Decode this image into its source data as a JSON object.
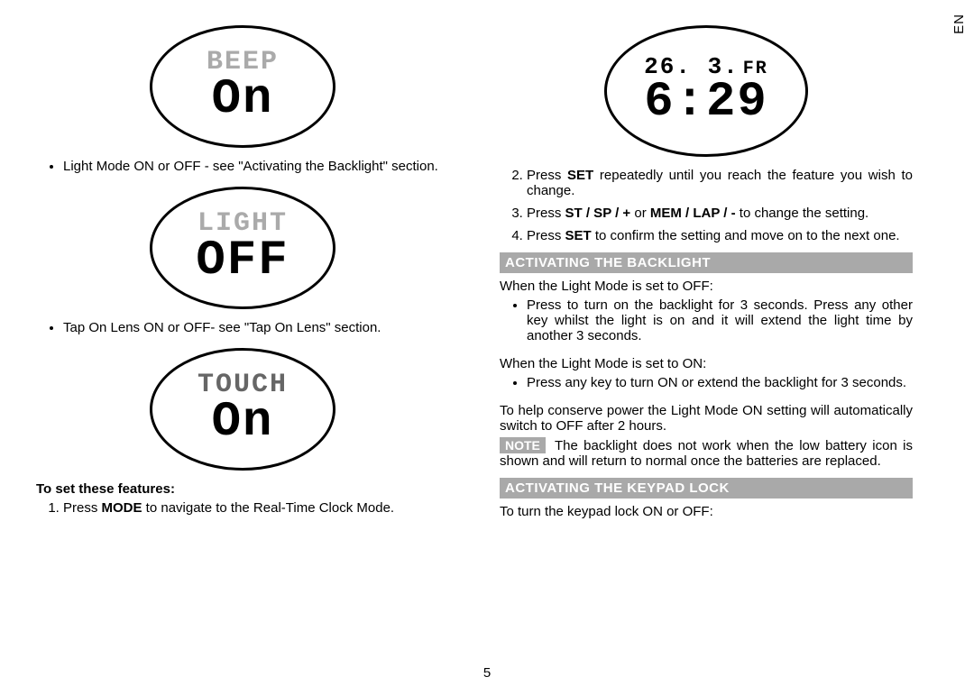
{
  "lang_tab": "EN",
  "page_number": "5",
  "left": {
    "lcd_beep_top": "BEEP",
    "lcd_beep_main": "On",
    "bullet_light_mode": "Light Mode ON or OFF - see \"Activating the Backlight\" section.",
    "lcd_light_top": "LIGHT",
    "lcd_light_main": "OFF",
    "bullet_touch": "Tap On Lens ON or OFF- see \"Tap On Lens\" section.",
    "lcd_touch_top": "TOUCH",
    "lcd_touch_main": "On",
    "subhead": "To set these features:",
    "step1_pre": "Press ",
    "step1_mode": "MODE",
    "step1_post": " to navigate to the Real-Time Clock Mode."
  },
  "right": {
    "lcd_date": "26. 3.",
    "lcd_day": "FR",
    "lcd_time": "6:29",
    "step2_pre": "Press ",
    "step2_set": "SET",
    "step2_post": " repeatedly until you reach the feature you wish to change.",
    "step3_pre": "Press ",
    "step3_keys1": "ST / SP / +",
    "step3_mid": " or ",
    "step3_keys2": "MEM / LAP / -",
    "step3_post": " to change the setting.",
    "step4_pre": "Press ",
    "step4_set": "SET",
    "step4_post": " to confirm the setting and move on to the next one.",
    "heading_backlight": "ACTIVATING THE BACKLIGHT",
    "bl_intro_off": "When the Light Mode is set to OFF:",
    "bl_off_bullet": "Press to turn on the backlight for 3 seconds. Press any other key whilst the light is on and it will extend the light time by another 3 seconds.",
    "bl_intro_on": "When the Light Mode is set to ON:",
    "bl_on_bullet": "Press any key to turn ON or extend the backlight for 3 seconds.",
    "bl_conserve": "To help conserve power the Light Mode ON setting will automatically switch to OFF after 2 hours.",
    "note_label": "NOTE",
    "note_text": " The backlight does not work when the low battery icon is shown and will return to normal once the batteries are replaced.",
    "heading_keypad": "ACTIVATING THE KEYPAD LOCK",
    "keypad_intro": "To turn the keypad lock ON or OFF:"
  }
}
